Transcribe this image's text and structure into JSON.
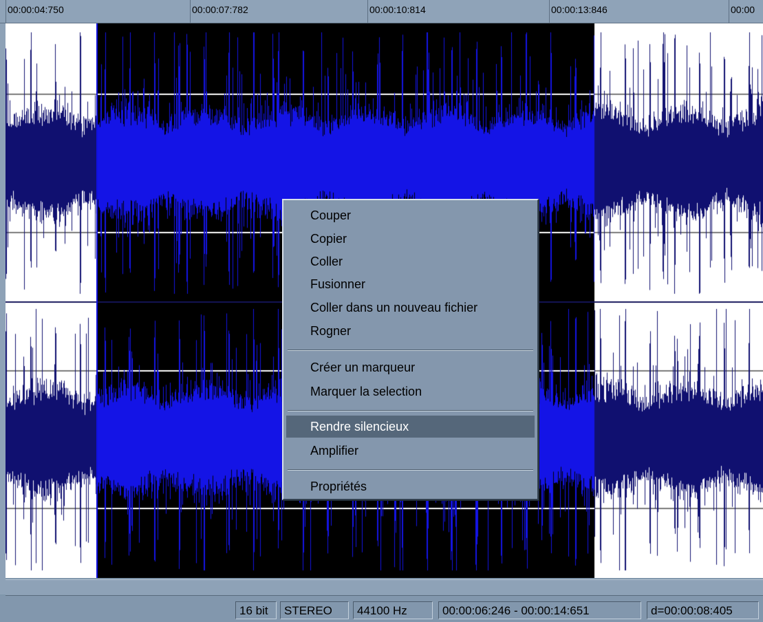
{
  "timeline": {
    "ticks": [
      "00:00:04:750",
      "00:00:07:782",
      "00:00:10:814",
      "00:00:13:846",
      "00:00"
    ]
  },
  "colors": {
    "waveform_unselected": "#101070",
    "waveform_selected": "#1414e6",
    "selection_background": "#000000",
    "unselected_background": "#ffffff",
    "gridline_unselected": "#7a7a7a",
    "gridline_selected": "#ffffff",
    "channel_divider": "#14145a"
  },
  "context_menu": {
    "items": [
      {
        "label": "Couper"
      },
      {
        "label": "Copier"
      },
      {
        "label": "Coller"
      },
      {
        "label": "Fusionner"
      },
      {
        "label": "Coller dans un nouveau fichier"
      },
      {
        "label": "Rogner"
      },
      {
        "label": "Créer un marqueur"
      },
      {
        "label": "Marquer la selection"
      },
      {
        "label": "Rendre silencieux",
        "highlighted": true
      },
      {
        "label": "Amplifier"
      },
      {
        "label": "Propriétés"
      }
    ]
  },
  "status": {
    "bit_depth": "16 bit",
    "channels": "STEREO",
    "sample_rate": "44100 Hz",
    "selection_range": "00:00:06:246 - 00:00:14:651",
    "duration": "d=00:00:08:405"
  }
}
